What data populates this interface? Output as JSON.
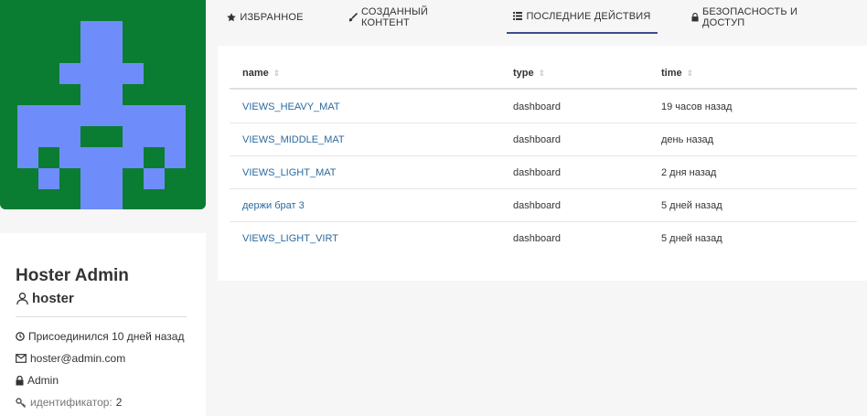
{
  "profile": {
    "name": "Hoster Admin",
    "username": "hoster",
    "joined": "Присоединился 10 дней назад",
    "email": "hoster@admin.com",
    "role": "Admin",
    "id_label": "идентификатор:",
    "id_value": "2",
    "avatar_colors": {
      "background": "#0a7d32",
      "foreground": "#6f8cfb"
    }
  },
  "tabs": [
    {
      "label": "ИЗБРАННОЕ",
      "icon": "star-icon",
      "active": false
    },
    {
      "label": "СОЗДАННЫЙ КОНТЕНТ",
      "icon": "paintbrush-icon",
      "active": false
    },
    {
      "label": "ПОСЛЕДНИЕ ДЕЙСТВИЯ",
      "icon": "list-icon",
      "active": true
    },
    {
      "label": "БЕЗОПАСНОСТЬ И ДОСТУП",
      "icon": "lock-icon",
      "active": false
    }
  ],
  "table": {
    "columns": [
      "name",
      "type",
      "time"
    ],
    "rows": [
      {
        "name": "VIEWS_HEAVY_MAT",
        "type": "dashboard",
        "time": "19 часов назад"
      },
      {
        "name": "VIEWS_MIDDLE_MAT",
        "type": "dashboard",
        "time": "день назад"
      },
      {
        "name": "VIEWS_LIGHT_MAT",
        "type": "dashboard",
        "time": "2 дня назад"
      },
      {
        "name": "держи брат 3",
        "type": "dashboard",
        "time": "5 дней назад"
      },
      {
        "name": "VIEWS_LIGHT_VIRT",
        "type": "dashboard",
        "time": "5 дней назад"
      }
    ]
  },
  "colors": {
    "accent": "#3c4f8a",
    "link": "#2b6a9e"
  }
}
